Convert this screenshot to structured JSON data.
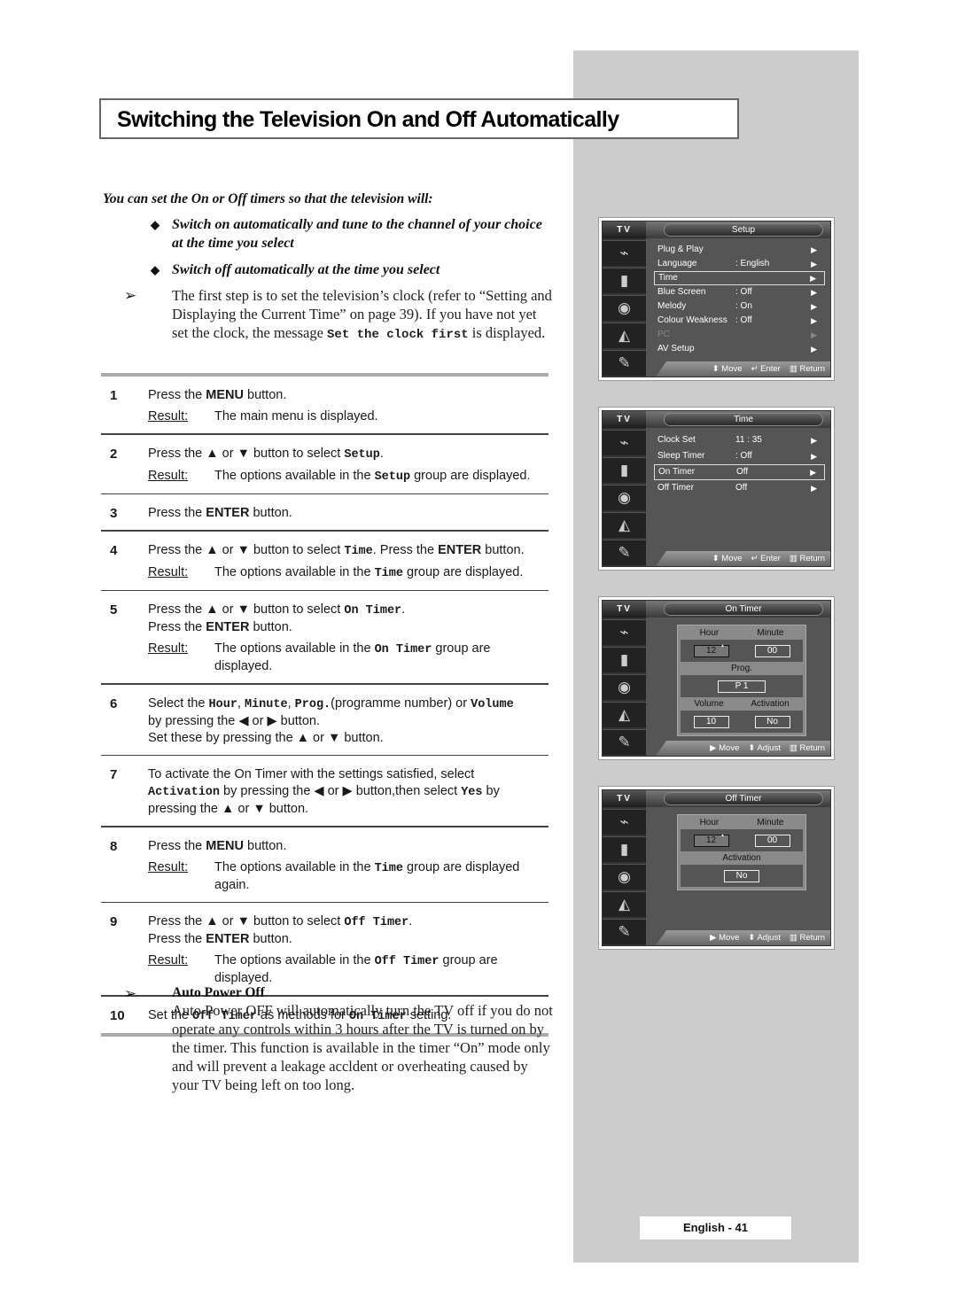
{
  "page": {
    "title": "Switching the Television On and Off Automatically",
    "page_number": "English - 41"
  },
  "intro": {
    "lead": "You can set the On or Off timers so that the television will:",
    "bullets": [
      "Switch on automatically and tune to the channel of your choice at the time you select",
      "Switch off automatically at the time you select"
    ],
    "note_pre": "The first step is to set the television’s clock (refer to “Setting and Displaying the Current Time” on page 39). If you have not yet set the clock, the message ",
    "note_code": "Set the clock first",
    "note_post": " is displayed."
  },
  "steps": {
    "result_label": "Result:",
    "s1": {
      "num": "1",
      "a": "Press the ",
      "b": "MENU",
      "c": " button.",
      "result": "The main menu is displayed."
    },
    "s2": {
      "num": "2",
      "a": "Press the ▲ or ▼ button to select ",
      "code": "Setup",
      "c": ".",
      "r1": "The options available in the ",
      "rcode": "Setup",
      "r2": " group are displayed."
    },
    "s3": {
      "num": "3",
      "a": "Press the ",
      "b": "ENTER",
      "c": " button."
    },
    "s4": {
      "num": "4",
      "a": "Press the ▲ or ▼ button to select ",
      "code": "Time",
      "c": ". Press the ",
      "b": "ENTER",
      "d": " button.",
      "r1": "The options available in the ",
      "rcode": "Time",
      "r2": " group are displayed."
    },
    "s5": {
      "num": "5",
      "a": "Press the ▲ or ▼ button to select ",
      "code": "On Timer",
      "c": ".",
      "l2a": "Press the ",
      "l2b": "ENTER",
      "l2c": " button.",
      "r1": "The options available in the ",
      "rcode": "On Timer",
      "r2": " group are displayed."
    },
    "s6": {
      "num": "6",
      "a": "Select the ",
      "c1": "Hour",
      "sep1": ", ",
      "c2": "Minute",
      "sep2": ", ",
      "c3": "Prog.",
      "mid": "(programme number) or ",
      "c4": "Volume",
      "l2": "by pressing the ◀ or ▶ button.",
      "l3": "Set these by pressing the ▲ or ▼ button."
    },
    "s7": {
      "num": "7",
      "a": "To activate the On Timer with the settings satisfied, select",
      "code1": "Activation",
      "b": " by pressing the ◀ or ▶ button,then select ",
      "code2": "Yes",
      "c": " by",
      "l3": "pressing the ▲ or ▼ button."
    },
    "s8": {
      "num": "8",
      "a": "Press the ",
      "b": "MENU",
      "c": " button.",
      "r1": "The options available in the ",
      "rcode": "Time",
      "r2": " group are displayed again."
    },
    "s9": {
      "num": "9",
      "a": "Press the ▲ or ▼ button to select ",
      "code": "Off Timer",
      "c": ".",
      "l2a": "Press the ",
      "l2b": "ENTER",
      "l2c": " button.",
      "r1": "The options available in the ",
      "rcode": "Off Timer",
      "r2": " group are displayed."
    },
    "s10": {
      "num": "10",
      "a": "Set the ",
      "code1": "Off Timer",
      "b": " as methods for ",
      "code2": "On Timer",
      "c": " setting."
    }
  },
  "auto_power_off": {
    "heading": "Auto Power Off",
    "body": "Auto Power OFF will automatically turn the TV off if you do not operate any controls within 3 hours after the TV is turned on by the timer. This function is available in the timer “On” mode only and will prevent a leakage accldent or overheating caused by your TV being left on too long."
  },
  "osd": {
    "tv_label": "TV",
    "icons": [
      "plug-icon",
      "picture-icon",
      "speaker-icon",
      "channel-icon",
      "setup-icon"
    ],
    "footer_nav": {
      "move": "Move",
      "enter": "Enter",
      "return": "Return",
      "adjust": "Adjust"
    },
    "setup": {
      "title": "Setup",
      "items": [
        {
          "label": "Plug & Play",
          "value": ""
        },
        {
          "label": "Language",
          "value": ": English"
        },
        {
          "label": "Time",
          "value": "",
          "selected": true
        },
        {
          "label": "Blue Screen",
          "value": ": Off"
        },
        {
          "label": "Melody",
          "value": ": On"
        },
        {
          "label": "Colour Weakness",
          "value": ": Off"
        },
        {
          "label": "PC",
          "value": "",
          "disabled": true
        },
        {
          "label": "AV Setup",
          "value": ""
        }
      ]
    },
    "time": {
      "title": "Time",
      "items": [
        {
          "label": "Clock Set",
          "value": "11 : 35"
        },
        {
          "label": "Sleep Timer",
          "value": ": Off"
        },
        {
          "label": "On Timer",
          "value": "Off",
          "selected": true
        },
        {
          "label": "Off Timer",
          "value": "Off"
        }
      ]
    },
    "on_timer": {
      "title": "On Timer",
      "hour_label": "Hour",
      "minute_label": "Minute",
      "hour": "12",
      "minute": "00",
      "prog_label": "Prog.",
      "prog": "P 1",
      "volume_label": "Volume",
      "activation_label": "Activation",
      "volume": "10",
      "activation": "No"
    },
    "off_timer": {
      "title": "Off Timer",
      "hour_label": "Hour",
      "minute_label": "Minute",
      "hour": "12",
      "minute": "00",
      "activation_label": "Activation",
      "activation": "No"
    }
  }
}
